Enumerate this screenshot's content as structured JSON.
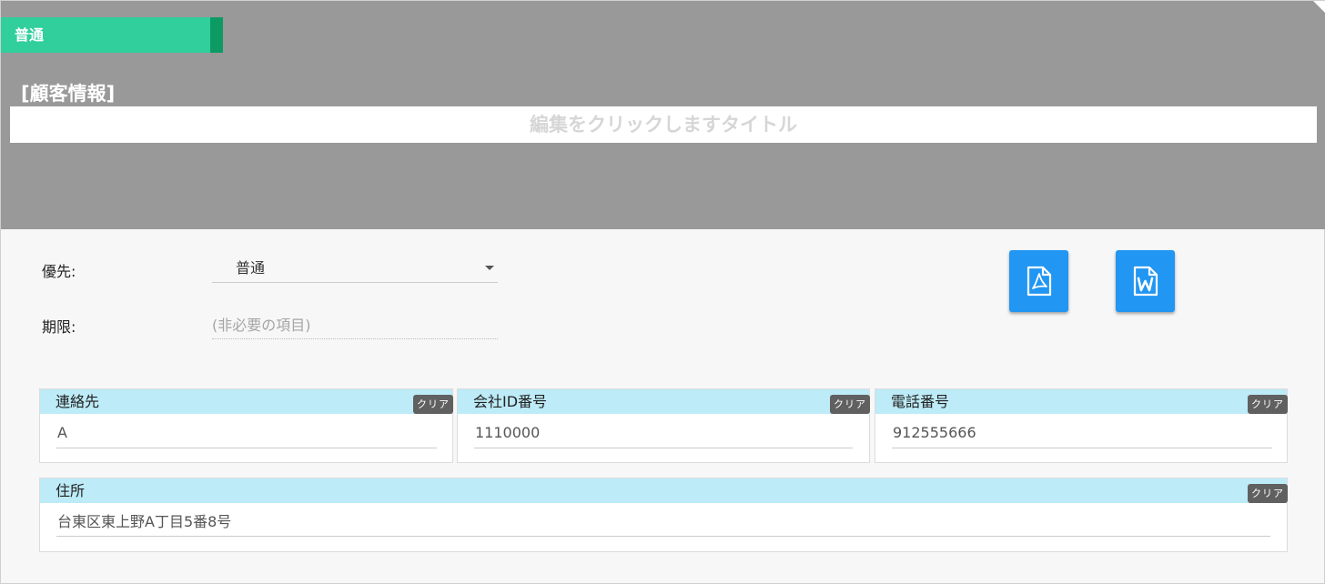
{
  "priority_tag": "普通",
  "section_label": "[顧客情報]",
  "title": {
    "placeholder": "編集をクリックしますタイトル"
  },
  "form": {
    "priority_label": "優先:",
    "priority_value": "普通",
    "deadline_label": "期限:",
    "deadline_placeholder": "(非必要の項目)"
  },
  "buttons": {
    "pdf_icon": "pdf-file-icon",
    "word_icon": "word-file-icon"
  },
  "fields": [
    {
      "label": "連絡先",
      "value": "A",
      "clear": "クリア"
    },
    {
      "label": "会社ID番号",
      "value": "1110000",
      "clear": "クリア"
    },
    {
      "label": "電話番号",
      "value": "912555666",
      "clear": "クリア"
    },
    {
      "label": "住所",
      "value": "台東区東上野A丁目5番8号",
      "clear": "クリア"
    }
  ],
  "colors": {
    "header": "#999999",
    "tag": "#30cf9c",
    "tag_accent": "#0d9b63",
    "button": "#2196f3",
    "card_header": "#bdebf7",
    "clear": "#606060"
  }
}
